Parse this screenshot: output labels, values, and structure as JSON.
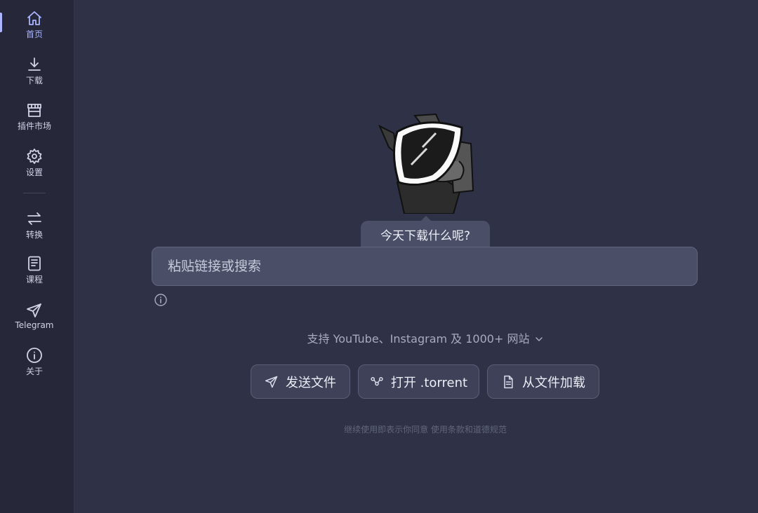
{
  "sidebar": {
    "items": [
      {
        "label": "首页",
        "icon": "home-icon",
        "active": true
      },
      {
        "label": "下载",
        "icon": "download-icon"
      },
      {
        "label": "插件市场",
        "icon": "store-icon"
      },
      {
        "label": "设置",
        "icon": "gear-icon"
      },
      {
        "label": "转换",
        "icon": "convert-icon"
      },
      {
        "label": "课程",
        "icon": "book-icon"
      },
      {
        "label": "Telegram",
        "icon": "send-icon"
      },
      {
        "label": "关于",
        "icon": "info-icon"
      }
    ]
  },
  "main": {
    "speech": "今天下载什么呢?",
    "search_placeholder": "粘贴链接或搜索",
    "support_text": "支持 YouTube、Instagram 及 1000+ 网站",
    "buttons": {
      "send_file": "发送文件",
      "open_torrent": "打开 .torrent",
      "load_file": "从文件加载"
    },
    "terms": "继续使用即表示你同意 使用条款和道德规范"
  },
  "colors": {
    "background": "#2f3146",
    "sidebar": "#262839",
    "accent": "#a9b4ff"
  }
}
